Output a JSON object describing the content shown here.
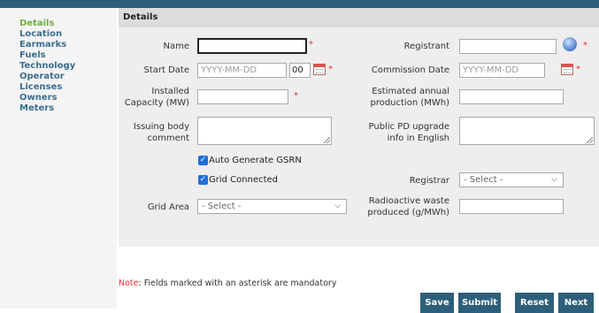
{
  "nav": [
    "Details",
    "Location",
    "Earmarks",
    "Fuels",
    "Technology",
    "Operator",
    "Licenses",
    "Owners",
    "Meters"
  ],
  "section_title": "Details",
  "fields": {
    "name": "Name",
    "start_date": "Start Date",
    "start_date_placeholder": "YYYY-MM-DD",
    "start_hour": "00",
    "installed_capacity": [
      "Installed",
      "Capacity (MW)"
    ],
    "issuing_comment": [
      "Issuing body",
      "comment"
    ],
    "registrant": "Registrant",
    "commission_date": "Commission Date",
    "commission_placeholder": "YYYY-MM-DD",
    "est_production": [
      "Estimated annual",
      "production (MWh)"
    ],
    "public_pd": [
      "Public PD upgrade",
      "info in English"
    ],
    "auto_gsrn": "Auto Generate GSRN",
    "grid_connected": "Grid Connected",
    "registrar": "Registrar",
    "grid_area": "Grid Area",
    "radioactive": [
      "Radioactive waste",
      "produced (g/MWh)"
    ],
    "select_placeholder": "- Select -"
  },
  "required_mark": "*",
  "note_label": "Note",
  "note_text": ": Fields marked with an asterisk are mandatory",
  "buttons": {
    "save": "Save",
    "submit": "Submit",
    "reset": "Reset",
    "next": "Next"
  },
  "checkbox_mark": "✓",
  "chevron": "⌵"
}
